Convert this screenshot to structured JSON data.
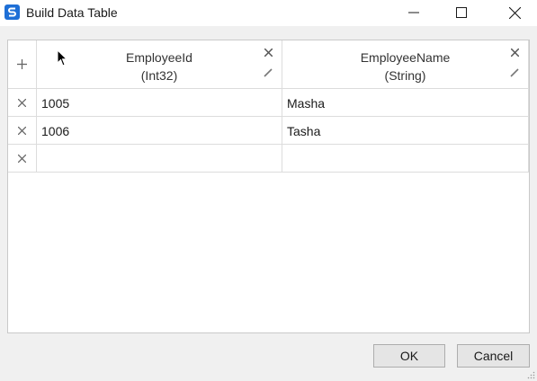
{
  "window": {
    "title": "Build Data Table"
  },
  "table": {
    "columns": [
      {
        "name": "EmployeeId",
        "type": "(Int32)"
      },
      {
        "name": "EmployeeName",
        "type": "(String)"
      }
    ],
    "rows": [
      [
        "1005",
        "Masha"
      ],
      [
        "1006",
        "Tasha"
      ],
      [
        "",
        ""
      ]
    ]
  },
  "buttons": {
    "ok": "OK",
    "cancel": "Cancel"
  },
  "icons": {
    "app": "app-logo-icon",
    "minimize": "minimize-icon",
    "maximize": "maximize-icon",
    "close": "close-icon",
    "add_column": "plus-icon",
    "remove": "remove-icon",
    "edit": "pencil-icon",
    "resize": "resize-grip-icon"
  },
  "colors": {
    "accent": "#1e6fd6"
  }
}
